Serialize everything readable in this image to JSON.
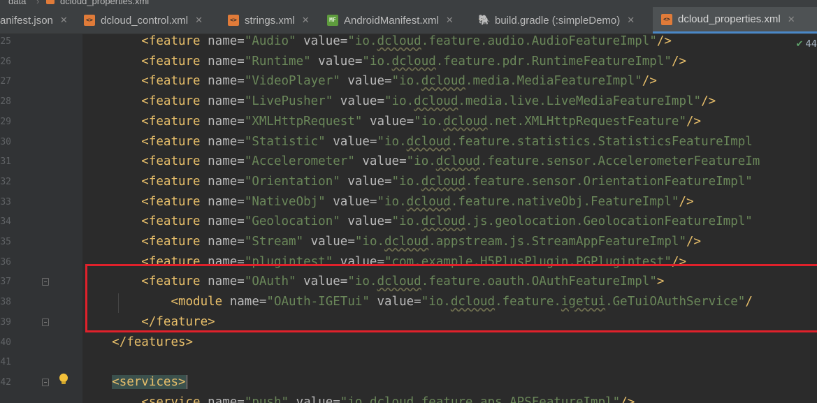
{
  "breadcrumb": {
    "items": [
      "data",
      "dcloud_properties.xml"
    ]
  },
  "tabs": [
    {
      "label": "anifest.json",
      "icon": "none",
      "active": false,
      "closable": true
    },
    {
      "label": "dcloud_control.xml",
      "icon": "xml-file-icon",
      "active": false,
      "closable": true
    },
    {
      "label": "strings.xml",
      "icon": "xml-file-icon",
      "active": false,
      "closable": true
    },
    {
      "label": "AndroidManifest.xml",
      "icon": "manifest-file-icon",
      "active": false,
      "closable": true
    },
    {
      "label": "build.gradle (:simpleDemo)",
      "icon": "gradle-file-icon",
      "active": false,
      "closable": true
    },
    {
      "label": "dcloud_properties.xml",
      "icon": "xml-file-icon",
      "active": true,
      "closable": true
    }
  ],
  "gutter": {
    "line_numbers": [
      "25",
      "26",
      "27",
      "28",
      "29",
      "30",
      "31",
      "32",
      "33",
      "34",
      "35",
      "36",
      "37",
      "38",
      "39",
      "40",
      "41",
      "42"
    ]
  },
  "inspection": {
    "count": "44"
  },
  "code": {
    "lines": [
      {
        "indent": "        ",
        "tag": "feature",
        "name": "Audio",
        "value": "io.dcloud.feature.audio.AudioFeatureImpl",
        "close": "\"/>"
      },
      {
        "indent": "        ",
        "tag": "feature",
        "name": "Runtime",
        "value": "io.dcloud.feature.pdr.RuntimeFeatureImpl",
        "close": "\"/>"
      },
      {
        "indent": "        ",
        "tag": "feature",
        "name": "VideoPlayer",
        "value": "io.dcloud.media.MediaFeatureImpl",
        "close": "\"/>"
      },
      {
        "indent": "        ",
        "tag": "feature",
        "name": "LivePusher",
        "value": "io.dcloud.media.live.LiveMediaFeatureImpl",
        "close": "\"/>"
      },
      {
        "indent": "        ",
        "tag": "feature",
        "name": "XMLHttpRequest",
        "value": "io.dcloud.net.XMLHttpRequestFeature",
        "close": "\"/>"
      },
      {
        "indent": "        ",
        "tag": "feature",
        "name": "Statistic",
        "value": "io.dcloud.feature.statistics.StatisticsFeatureImpl",
        "close": ""
      },
      {
        "indent": "        ",
        "tag": "feature",
        "name": "Accelerometer",
        "value": "io.dcloud.feature.sensor.AccelerometerFeatureIm",
        "close": ""
      },
      {
        "indent": "        ",
        "tag": "feature",
        "name": "Orientation",
        "value": "io.dcloud.feature.sensor.OrientationFeatureImpl",
        "close": "\""
      },
      {
        "indent": "        ",
        "tag": "feature",
        "name": "NativeObj",
        "value": "io.dcloud.feature.nativeObj.FeatureImpl",
        "close": "\"/>"
      },
      {
        "indent": "        ",
        "tag": "feature",
        "name": "Geolocation",
        "value": "io.dcloud.js.geolocation.GeolocationFeatureImpl",
        "close": "\""
      },
      {
        "indent": "        ",
        "tag": "feature",
        "name": "Stream",
        "value": "io.dcloud.appstream.js.StreamAppFeatureImpl",
        "close": "\"/>"
      },
      {
        "indent": "        ",
        "tag": "feature",
        "name": "plugintest",
        "value": "com.example.H5PlusPlugin.PGPlugintest",
        "close": "\"/>"
      },
      {
        "indent": "        ",
        "tag": "feature",
        "name": "OAuth",
        "value": "io.dcloud.feature.oauth.OAuthFeatureImpl",
        "close": "\">"
      },
      {
        "indent": "            ",
        "tag": "module",
        "name": "OAuth-IGETui",
        "value": "io.dcloud.feature.igetui.GeTuiOAuthService",
        "close": "\"/"
      },
      {
        "indent": "        ",
        "raw": "</feature>"
      },
      {
        "indent": "    ",
        "raw": "</features>"
      },
      {
        "indent": "",
        "raw": ""
      },
      {
        "indent": "    ",
        "raw": "<services>"
      },
      {
        "indent": "        ",
        "tag": "service",
        "name": "push",
        "value": "io.dcloud.feature.aps.APSFeatureImpl",
        "close": "\"/>"
      }
    ]
  },
  "annotation": {
    "color": "#e0212b"
  }
}
